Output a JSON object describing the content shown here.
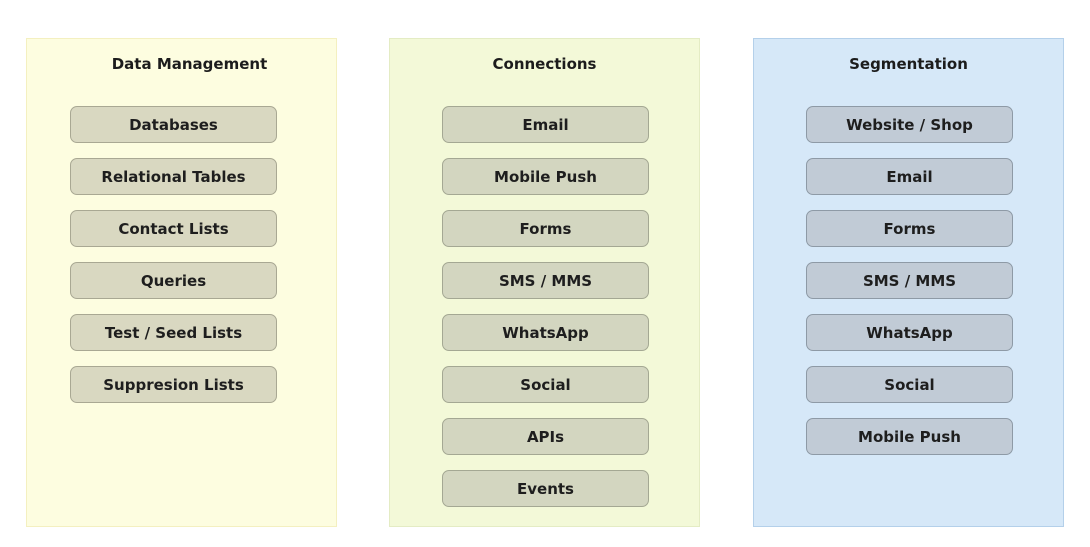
{
  "panels": [
    {
      "title": "Data Management",
      "items": [
        "Databases",
        "Relational Tables",
        "Contact Lists",
        "Queries",
        "Test / Seed Lists",
        "Suppresion Lists"
      ]
    },
    {
      "title": "Connections",
      "items": [
        "Email",
        "Mobile Push",
        "Forms",
        "SMS / MMS",
        "WhatsApp",
        "Social",
        "APIs",
        "Events"
      ]
    },
    {
      "title": "Segmentation",
      "items": [
        "Website / Shop",
        "Email",
        "Forms",
        "SMS / MMS",
        "WhatsApp",
        "Social",
        "Mobile Push"
      ]
    }
  ]
}
